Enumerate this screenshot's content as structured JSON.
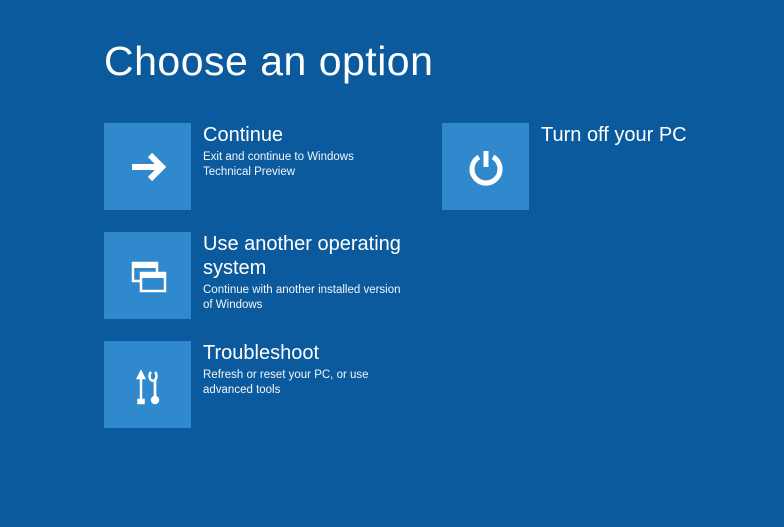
{
  "page_title": "Choose an option",
  "options": {
    "continue": {
      "title": "Continue",
      "desc": "Exit and continue to Windows Technical Preview"
    },
    "another_os": {
      "title": "Use another operating system",
      "desc": "Continue with another installed version of Windows"
    },
    "troubleshoot": {
      "title": "Troubleshoot",
      "desc": "Refresh or reset your PC, or use advanced tools"
    },
    "turn_off": {
      "title": "Turn off your PC",
      "desc": ""
    }
  }
}
